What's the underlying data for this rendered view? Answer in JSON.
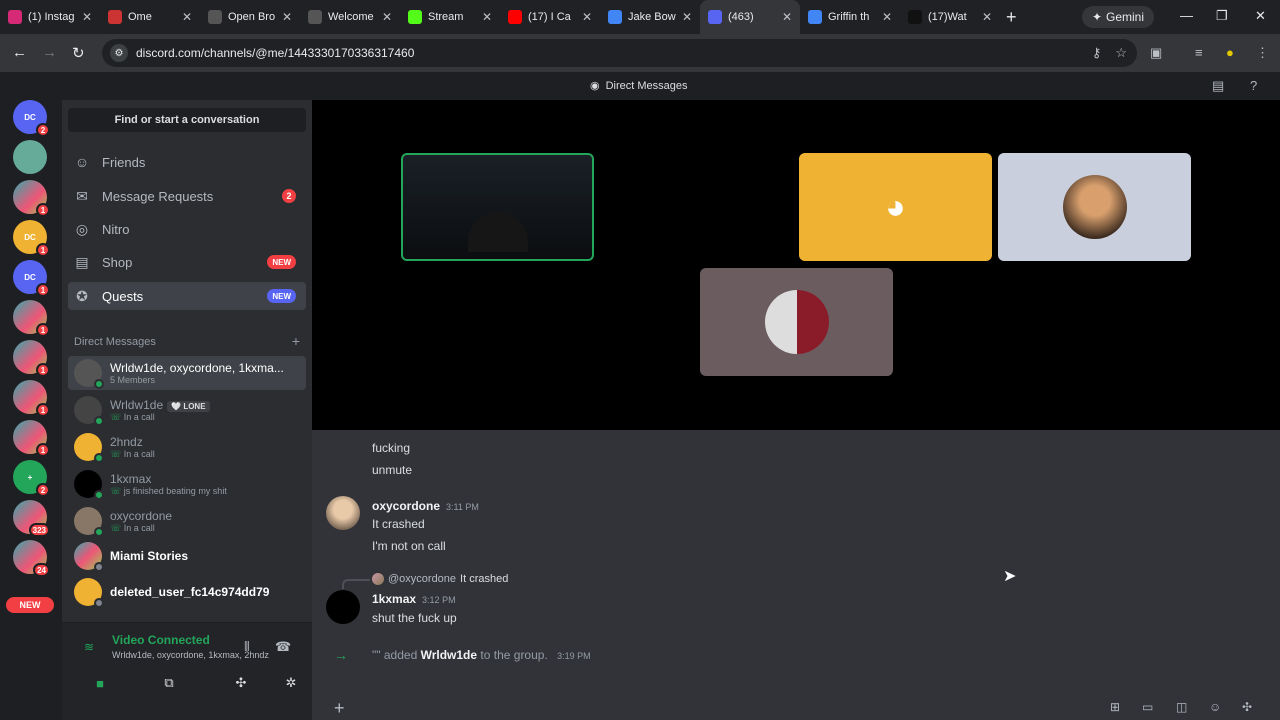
{
  "browser": {
    "tabs": [
      {
        "title": "(1) Instag",
        "color": "#d62976"
      },
      {
        "title": "Ome",
        "color": "#c33"
      },
      {
        "title": "Open Bro",
        "color": "#555"
      },
      {
        "title": "Welcome",
        "color": "#555"
      },
      {
        "title": "Stream",
        "color": "#53fc18"
      },
      {
        "title": "(17) I Ca",
        "color": "#ff0000"
      },
      {
        "title": "Jake Bow",
        "color": "#4285f4"
      },
      {
        "title": "(463)",
        "color": "#5865f2"
      },
      {
        "title": "Griffin th",
        "color": "#4285f4"
      },
      {
        "title": "(17)Wat",
        "color": "#111"
      }
    ],
    "active_tab": 7,
    "gemini_label": "Gemini",
    "url": "discord.com/channels/@me/1443330170336317460"
  },
  "discord": {
    "top_title": "Direct Messages",
    "servers": [
      {
        "badge": "2",
        "color": "#5865f2",
        "label": "DC"
      },
      {
        "badge": "",
        "color": "#6a9",
        "label": ""
      },
      {
        "badge": "1",
        "color": "img",
        "label": ""
      },
      {
        "badge": "1",
        "color": "#f0b232",
        "label": "DC"
      },
      {
        "badge": "1",
        "color": "#5865f2",
        "label": "DC"
      },
      {
        "badge": "1",
        "color": "img",
        "label": ""
      },
      {
        "badge": "1",
        "color": "img",
        "label": ""
      },
      {
        "badge": "1",
        "color": "img",
        "label": ""
      },
      {
        "badge": "1",
        "color": "img",
        "label": ""
      },
      {
        "badge": "2",
        "color": "#23a55a",
        "label": "+"
      },
      {
        "badge": "323",
        "color": "img",
        "label": ""
      },
      {
        "badge": "24",
        "color": "img",
        "label": ""
      }
    ],
    "new_pill": "NEW",
    "find_label": "Find or start a conversation",
    "nav": [
      {
        "label": "Friends",
        "icon": "friends-icon",
        "glyph": "☺"
      },
      {
        "label": "Message Requests",
        "icon": "mail-icon",
        "glyph": "✉",
        "badge": "2"
      },
      {
        "label": "Nitro",
        "icon": "nitro-icon",
        "glyph": "◎"
      },
      {
        "label": "Shop",
        "icon": "shop-icon",
        "glyph": "▤",
        "tag": "NEW"
      },
      {
        "label": "Quests",
        "icon": "quests-icon",
        "glyph": "✪",
        "tag": "NEW"
      }
    ],
    "dm_header": "Direct Messages",
    "dm_add": "+",
    "dms": [
      {
        "name": "Wrldw1de, oxycordone, 1kxma...",
        "sub": "5 Members",
        "active": true,
        "avatar": "#555"
      },
      {
        "name": "Wrldw1de",
        "tag": "🤍 LONE",
        "sub": "In a call",
        "phone": true,
        "avatar": "#444"
      },
      {
        "name": "2hndz",
        "sub": "In a call",
        "phone": true,
        "avatar": "#f0b232"
      },
      {
        "name": "1kxmax",
        "sub": "js finished beating my shit",
        "phone": true,
        "avatar": "#000"
      },
      {
        "name": "oxycordone",
        "sub": "In a call",
        "phone": true,
        "avatar": "#876"
      },
      {
        "name": "Miami Stories",
        "sub": "",
        "bold": true,
        "avatar": "img"
      },
      {
        "name": "deleted_user_fc14c974dd79",
        "sub": "",
        "bold": true,
        "avatar": "#f0b232"
      }
    ],
    "voice": {
      "title": "Video Connected",
      "sub": "Wrldw1de, oxycordone, 1kxmax, 2hndz"
    },
    "messages": {
      "cont1": "fucking",
      "cont2": "unmute",
      "m1_author": "oxycordone",
      "m1_time": "3:11 PM",
      "m1_line1": "It crashed",
      "m1_line2": "I'm not on call",
      "reply_to": "@oxycordone",
      "reply_text": "It crashed",
      "m2_author": "1kxmax",
      "m2_time": "3:12 PM",
      "m2_text": "shut the fuck up",
      "sys_user": "\"\"",
      "sys_action": "added",
      "sys_target": "Wrldw1de",
      "sys_rest": "to the group.",
      "sys_time": "3:19 PM"
    }
  }
}
